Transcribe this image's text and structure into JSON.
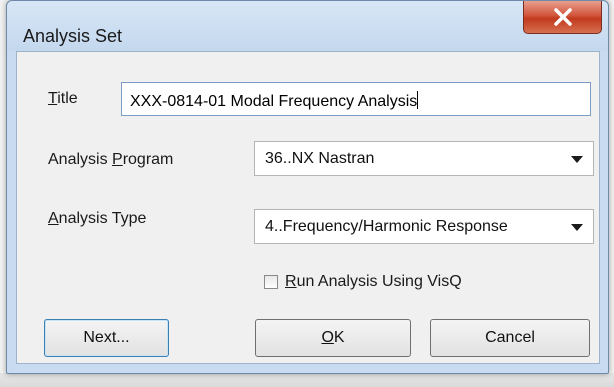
{
  "window": {
    "title": "Analysis Set",
    "close_icon": "close-icon"
  },
  "form": {
    "title_label_hotkey": "T",
    "title_label_rest": "itle",
    "title_value": "XXX-0814-01 Modal Frequency Analysis",
    "program_label_pre": "Analysis ",
    "program_label_hotkey": "P",
    "program_label_rest": "rogram",
    "program_value": "36..NX Nastran",
    "type_label_hotkey": "A",
    "type_label_rest": "nalysis Type",
    "type_value": "4..Frequency/Harmonic Response",
    "visq_label_hotkey": "R",
    "visq_label_rest": "un Analysis Using VisQ",
    "visq_checked": false
  },
  "buttons": {
    "next": "Next...",
    "ok_hotkey": "O",
    "ok_rest": "K",
    "cancel": "Cancel"
  },
  "colors": {
    "close_button": "#c23a1f",
    "frame": "#c9dbf0",
    "default_button_border": "#3c7fb1"
  }
}
